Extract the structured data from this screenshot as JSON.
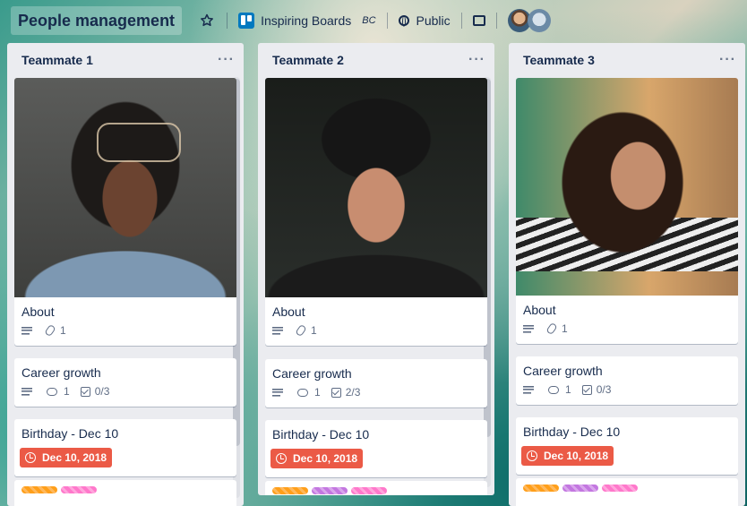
{
  "header": {
    "board_title": "People management",
    "workspace_name": "Inspiring Boards",
    "workspace_tag": "BC",
    "visibility": "Public"
  },
  "colors": {
    "due_badge": "#eb5a46",
    "label_orange": "#ff9f1a",
    "label_purple": "#c377e0",
    "label_pink": "#ff78cb"
  },
  "lists": [
    {
      "title": "Teammate 1",
      "cards": [
        {
          "title": "About",
          "attachments": "1"
        },
        {
          "title": "Career growth",
          "comments": "1",
          "checklist": "0/3"
        },
        {
          "title": "Birthday - Dec 10",
          "due": "Dec 10, 2018"
        }
      ]
    },
    {
      "title": "Teammate 2",
      "cards": [
        {
          "title": "About",
          "attachments": "1"
        },
        {
          "title": "Career growth",
          "comments": "1",
          "checklist": "2/3"
        },
        {
          "title": "Birthday - Dec 10",
          "due": "Dec 10, 2018"
        }
      ]
    },
    {
      "title": "Teammate 3",
      "cards": [
        {
          "title": "About",
          "attachments": "1"
        },
        {
          "title": "Career growth",
          "comments": "1",
          "checklist": "0/3"
        },
        {
          "title": "Birthday - Dec 10",
          "due": "Dec 10, 2018"
        }
      ]
    }
  ]
}
